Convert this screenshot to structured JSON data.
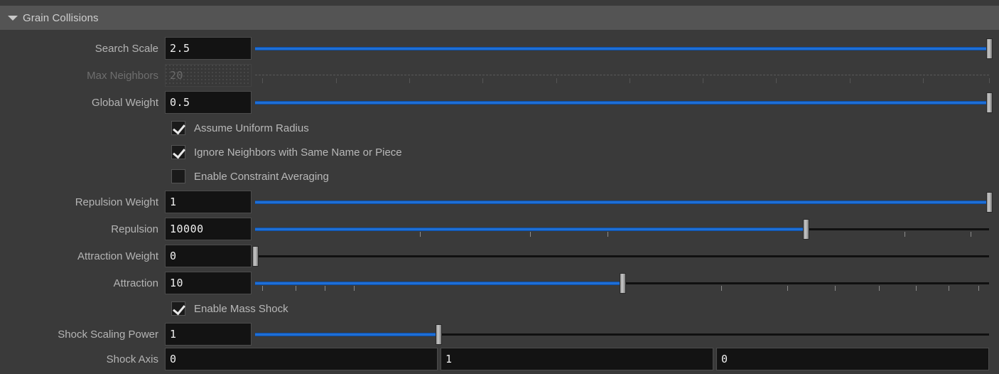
{
  "header": {
    "title": "Grain Collisions",
    "caret_icon": "caret-down-icon",
    "expanded": true
  },
  "colors": {
    "panel_bg": "#3a3a3a",
    "header_bg": "#545454",
    "field_bg": "#131313",
    "slider_fill": "#1f6fd6",
    "track": "#101010",
    "label": "#b4b4b4",
    "label_disabled": "#6e6e6e",
    "handle": "#c6c6c6"
  },
  "parameters": [
    {
      "id": "search-scale",
      "label": "Search Scale",
      "value": "2.5",
      "disabled": false,
      "slider": {
        "fill_pct": 100,
        "handle_pct": 100,
        "ticks": []
      }
    },
    {
      "id": "max-neighbors",
      "label": "Max Neighbors",
      "value": "20",
      "disabled": true,
      "slider": {
        "fill_pct": 0,
        "handle_pct": 1,
        "ticks": [
          1,
          11,
          21,
          31,
          41,
          51,
          61,
          71,
          81,
          91,
          100
        ]
      }
    },
    {
      "id": "global-weight",
      "label": "Global Weight",
      "value": "0.5",
      "disabled": false,
      "slider": {
        "fill_pct": 100,
        "handle_pct": 100,
        "ticks": []
      }
    }
  ],
  "toggles": [
    {
      "id": "assume-uniform-radius",
      "label": "Assume Uniform Radius",
      "checked": true
    },
    {
      "id": "ignore-neighbors-same-name-or-piece",
      "label": "Ignore Neighbors with Same Name or Piece",
      "checked": true
    },
    {
      "id": "enable-constraint-averaging",
      "label": "Enable Constraint Averaging",
      "checked": false
    }
  ],
  "parameters2": [
    {
      "id": "repulsion-weight",
      "label": "Repulsion Weight",
      "value": "1",
      "disabled": false,
      "slider": {
        "fill_pct": 100,
        "handle_pct": 100,
        "ticks": []
      }
    },
    {
      "id": "repulsion",
      "label": "Repulsion",
      "value": "10000",
      "disabled": false,
      "slider": {
        "fill_pct": 75,
        "handle_pct": 75,
        "ticks": [
          22.5,
          37.5,
          48,
          75,
          88.5,
          97.5,
          104,
          110,
          115,
          119.5,
          123.5
        ]
      }
    },
    {
      "id": "attraction-weight",
      "label": "Attraction Weight",
      "value": "0",
      "disabled": false,
      "slider": {
        "fill_pct": 0,
        "handle_pct": 0,
        "ticks": []
      }
    },
    {
      "id": "attraction",
      "label": "Attraction",
      "value": "10",
      "disabled": false,
      "slider": {
        "fill_pct": 50,
        "handle_pct": 50,
        "ticks": [
          1,
          5.5,
          9.5,
          13.5,
          50,
          63.5,
          72.5,
          79,
          85,
          90,
          94.5,
          98.5
        ]
      }
    }
  ],
  "toggles2": [
    {
      "id": "enable-mass-shock",
      "label": "Enable Mass Shock",
      "checked": true
    }
  ],
  "parameters3": [
    {
      "id": "shock-scaling-power",
      "label": "Shock Scaling Power",
      "value": "1",
      "disabled": false,
      "slider": {
        "fill_pct": 25,
        "handle_pct": 25,
        "ticks": []
      }
    }
  ],
  "vector": {
    "id": "shock-axis",
    "label": "Shock Axis",
    "values": [
      "0",
      "1",
      "0"
    ]
  }
}
